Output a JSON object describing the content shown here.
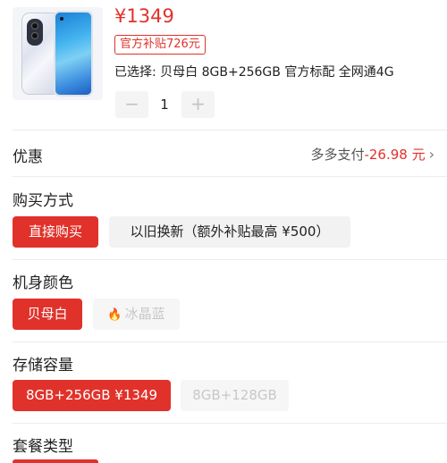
{
  "product": {
    "price": "¥1349",
    "subsidy_badge": "官方补贴726元",
    "selected": "已选择: 贝母白 8GB+256GB 官方标配 全网通4G",
    "quantity": "1",
    "minus_icon": "−",
    "plus_icon": "+"
  },
  "discount": {
    "title": "优惠",
    "label": "多多支付",
    "amount": "-26.98 元",
    "chevron": "›"
  },
  "purchase_method": {
    "title": "购买方式",
    "options": [
      "直接购买",
      "以旧换新（额外补贴最高 ¥500）"
    ]
  },
  "color": {
    "title": "机身颜色",
    "options": [
      "贝母白",
      "冰晶蓝"
    ],
    "flame": "🔥"
  },
  "storage": {
    "title": "存储容量",
    "options": [
      "8GB+256GB ¥1349",
      "8GB+128GB"
    ]
  },
  "package": {
    "title": "套餐类型"
  },
  "colors": {
    "accent": "#e0322b",
    "option_bg": "#f2f2f2",
    "disabled_text": "#c8c8c8"
  }
}
